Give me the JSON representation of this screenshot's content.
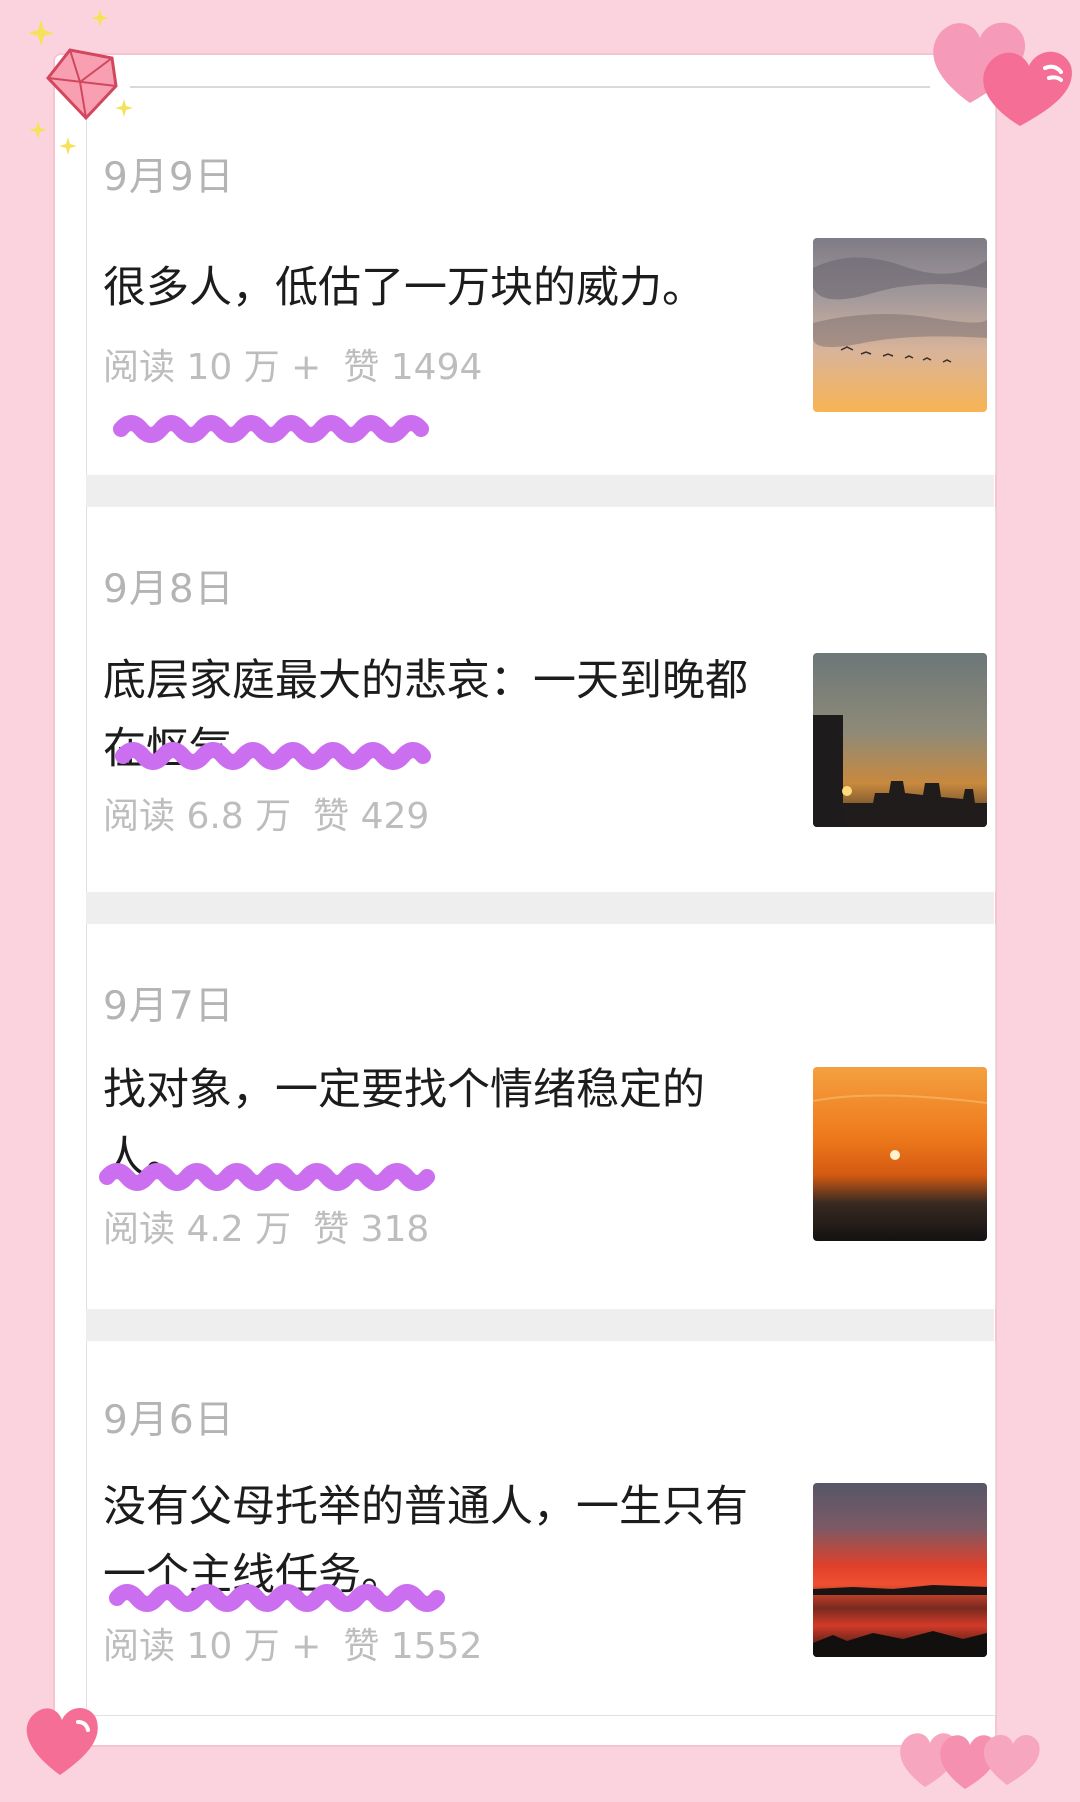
{
  "articles": [
    {
      "date": "9月9日",
      "title": "很多人，低估了一万块的威力。",
      "reads": "阅读 10 万 +",
      "likes": "赞 1494",
      "thumb_colors": [
        "#8c8790",
        "#e8b890",
        "#f6b25a"
      ]
    },
    {
      "date": "9月8日",
      "title": "底层家庭最大的悲哀：一天到晚都在怄气。",
      "reads": "阅读 6.8 万",
      "likes": "赞 429",
      "thumb_colors": [
        "#6f7b7c",
        "#c08a4a",
        "#2a2624"
      ]
    },
    {
      "date": "9月7日",
      "title": "找对象，一定要找个情绪稳定的人。",
      "reads": "阅读 4.2 万",
      "likes": "赞 318",
      "thumb_colors": [
        "#f2a040",
        "#e86418",
        "#1f1a18"
      ]
    },
    {
      "date": "9月6日",
      "title": "没有父母托举的普通人，一生只有一个主线任务。",
      "reads": "阅读 10 万 +",
      "likes": "赞 1552",
      "thumb_colors": [
        "#5c5a6c",
        "#e23a24",
        "#171414"
      ]
    }
  ],
  "decor": {
    "wave_color": "#cb6ff0",
    "heart_color": "#f56e96",
    "gem_color": "#f27a92",
    "sparkle_color": "#f6e15a"
  }
}
